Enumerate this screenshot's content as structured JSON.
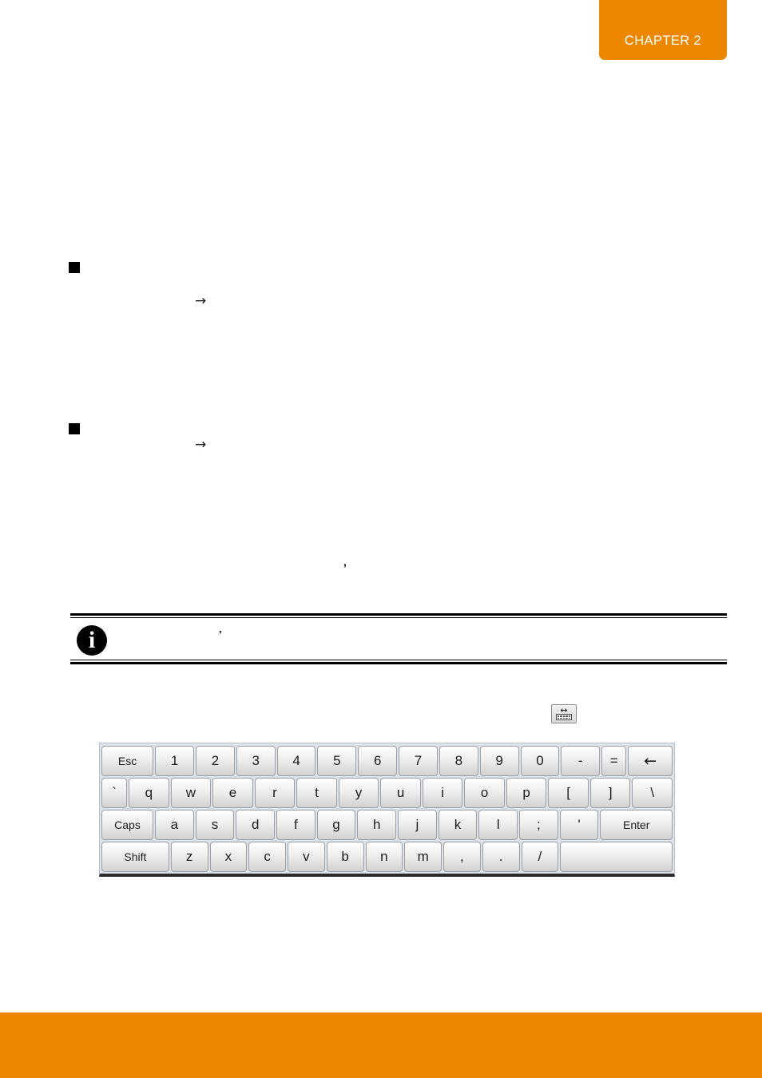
{
  "colors": {
    "brand_orange": "#ee8700",
    "page_background": "#ffffff",
    "keyboard_frame": "#dfe4ea",
    "key_face": "#f0f0f0",
    "text": "#000000"
  },
  "chapter_tab": {
    "label": "CHAPTER 2"
  },
  "body": {
    "bullets": [
      {
        "marker": "square-bullet",
        "arrow": "→"
      },
      {
        "marker": "square-bullet",
        "arrow": "→"
      }
    ],
    "tick_mark": "’"
  },
  "info_note": {
    "icon": "i",
    "text": "",
    "tick": "’"
  },
  "resize_icon": {
    "name": "resize-keyboard-icon",
    "arrows": "↔"
  },
  "keyboard": {
    "rows": [
      {
        "name": "number-row",
        "keys": [
          {
            "label": "Esc",
            "style": "wide-esc"
          },
          {
            "label": "1",
            "style": ""
          },
          {
            "label": "2",
            "style": ""
          },
          {
            "label": "3",
            "style": ""
          },
          {
            "label": "4",
            "style": ""
          },
          {
            "label": "5",
            "style": ""
          },
          {
            "label": "6",
            "style": ""
          },
          {
            "label": "7",
            "style": ""
          },
          {
            "label": "8",
            "style": ""
          },
          {
            "label": "9",
            "style": ""
          },
          {
            "label": "0",
            "style": ""
          },
          {
            "label": "-",
            "style": ""
          },
          {
            "label": "=",
            "style": "narrow"
          },
          {
            "label": "←",
            "style": "back"
          }
        ]
      },
      {
        "name": "top-letter-row",
        "keys": [
          {
            "label": "`",
            "style": "narrow"
          },
          {
            "label": "q",
            "style": ""
          },
          {
            "label": "w",
            "style": ""
          },
          {
            "label": "e",
            "style": ""
          },
          {
            "label": "r",
            "style": ""
          },
          {
            "label": "t",
            "style": ""
          },
          {
            "label": "y",
            "style": ""
          },
          {
            "label": "u",
            "style": ""
          },
          {
            "label": "i",
            "style": ""
          },
          {
            "label": "o",
            "style": ""
          },
          {
            "label": "p",
            "style": ""
          },
          {
            "label": "[",
            "style": ""
          },
          {
            "label": "]",
            "style": ""
          },
          {
            "label": "\\",
            "style": ""
          }
        ]
      },
      {
        "name": "home-letter-row",
        "keys": [
          {
            "label": "Caps",
            "style": "wide-caps"
          },
          {
            "label": "a",
            "style": ""
          },
          {
            "label": "s",
            "style": ""
          },
          {
            "label": "d",
            "style": ""
          },
          {
            "label": "f",
            "style": ""
          },
          {
            "label": "g",
            "style": ""
          },
          {
            "label": "h",
            "style": ""
          },
          {
            "label": "j",
            "style": ""
          },
          {
            "label": "k",
            "style": ""
          },
          {
            "label": "l",
            "style": ""
          },
          {
            "label": ";",
            "style": ""
          },
          {
            "label": "'",
            "style": ""
          },
          {
            "label": "Enter",
            "style": "wide-enter"
          }
        ]
      },
      {
        "name": "bottom-letter-row",
        "keys": [
          {
            "label": "Shift",
            "style": "wide-shift"
          },
          {
            "label": "z",
            "style": ""
          },
          {
            "label": "x",
            "style": ""
          },
          {
            "label": "c",
            "style": ""
          },
          {
            "label": "v",
            "style": ""
          },
          {
            "label": "b",
            "style": ""
          },
          {
            "label": "n",
            "style": ""
          },
          {
            "label": "m",
            "style": ""
          },
          {
            "label": ",",
            "style": ""
          },
          {
            "label": ".",
            "style": ""
          },
          {
            "label": "/",
            "style": ""
          },
          {
            "label": "",
            "style": "space"
          }
        ]
      }
    ]
  }
}
